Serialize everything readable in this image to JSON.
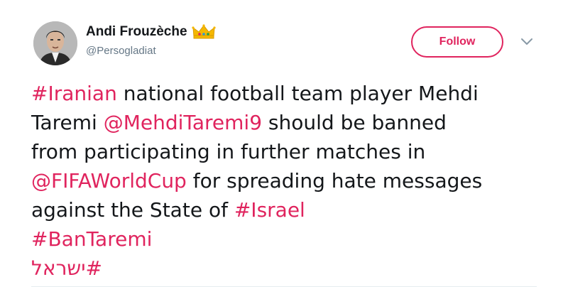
{
  "user": {
    "display_name": "Andi Frouzèche",
    "handle": "@Persogladiat"
  },
  "header": {
    "follow_label": "Follow"
  },
  "icons": {
    "badge": "crown-icon",
    "menu": "chevron-down-icon"
  },
  "colors": {
    "accent": "#e0245e",
    "text": "#14171a",
    "secondary_text": "#657786"
  },
  "tweet": {
    "lines": [
      [
        {
          "text": "#Iranian",
          "link": true
        },
        {
          "text": " national football team player Mehdi",
          "link": false
        }
      ],
      [
        {
          "text": "Taremi ",
          "link": false
        },
        {
          "text": "@MehdiTaremi9",
          "link": true
        },
        {
          "text": " should be banned",
          "link": false
        }
      ],
      [
        {
          "text": "from participating in further matches in",
          "link": false
        }
      ],
      [
        {
          "text": "@FIFAWorldCup",
          "link": true
        },
        {
          "text": " for spreading hate messages",
          "link": false
        }
      ],
      [
        {
          "text": "against the State of ",
          "link": false
        },
        {
          "text": "#Israel",
          "link": true
        }
      ],
      [
        {
          "text": "#BanTaremi",
          "link": true
        }
      ],
      [
        {
          "text": "#ישראל",
          "link": true,
          "rtl": true
        }
      ]
    ]
  }
}
